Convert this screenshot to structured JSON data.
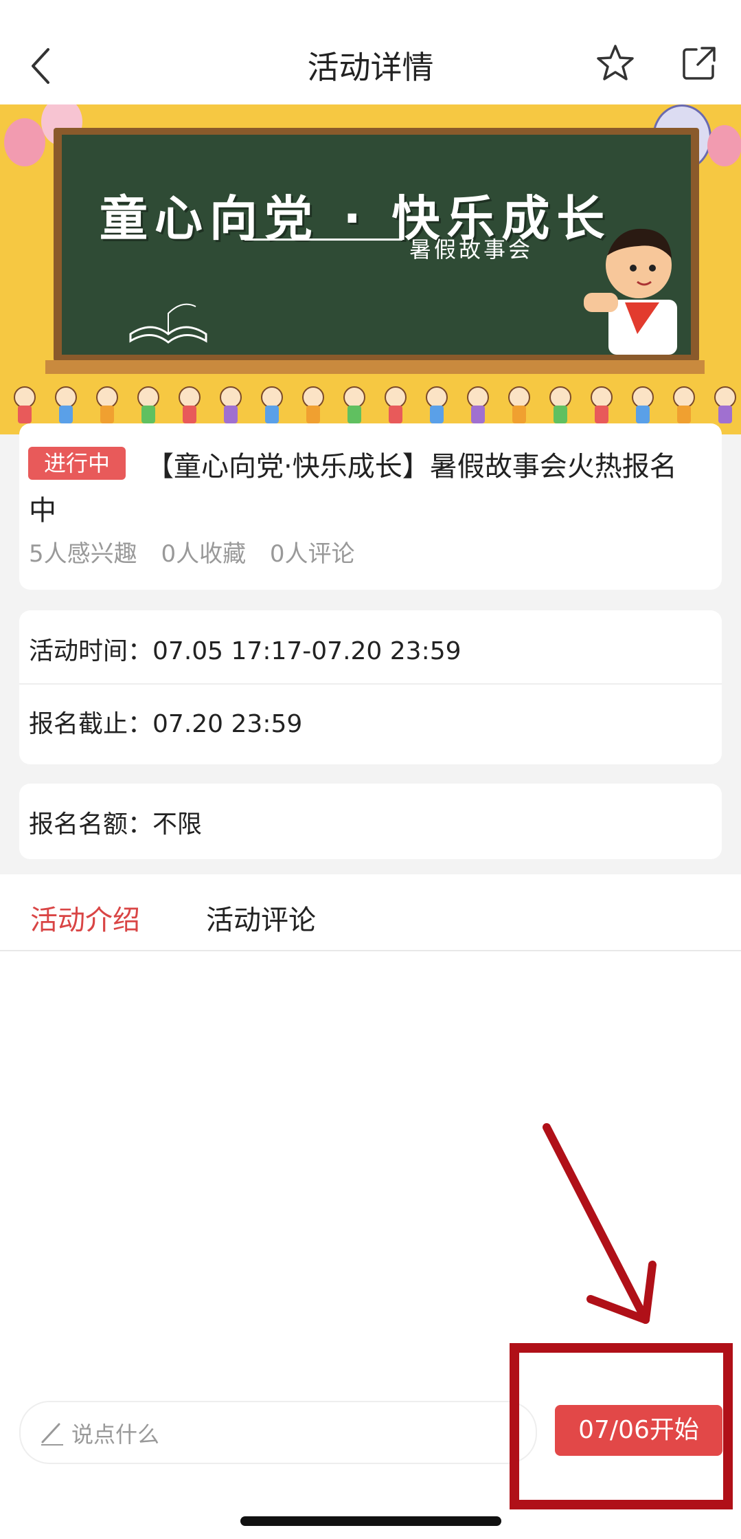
{
  "header": {
    "title": "活动详情"
  },
  "banner": {
    "headline": "童心向党 · 快乐成长",
    "subtitle": "暑假故事会"
  },
  "activity": {
    "status_badge": "进行中",
    "title_line1": "【童心向党·快乐成长】暑假故事会火热报名",
    "title_line2": "中",
    "stats": {
      "interested": "5人感兴趣",
      "favorites": "0人收藏",
      "comments": "0人评论"
    }
  },
  "details": {
    "time_label": "活动时间：",
    "time_value": "07.05 17:17-07.20 23:59",
    "deadline_label": "报名截止：",
    "deadline_value": "07.20 23:59",
    "quota_label": "报名名额：",
    "quota_value": "不限"
  },
  "tabs": [
    {
      "label": "活动介绍",
      "active": true
    },
    {
      "label": "活动评论",
      "active": false
    }
  ],
  "bottom": {
    "comment_placeholder": "说点什么",
    "start_button": "07/06开始"
  },
  "colors": {
    "accent": "#d94545",
    "badge": "#e85a5a",
    "highlight_annotation": "#b01018",
    "banner_bg": "#f6c842",
    "chalkboard": "#2f4b35"
  },
  "icons": [
    "back-chevron-icon",
    "star-icon",
    "share-icon",
    "pencil-icon"
  ]
}
